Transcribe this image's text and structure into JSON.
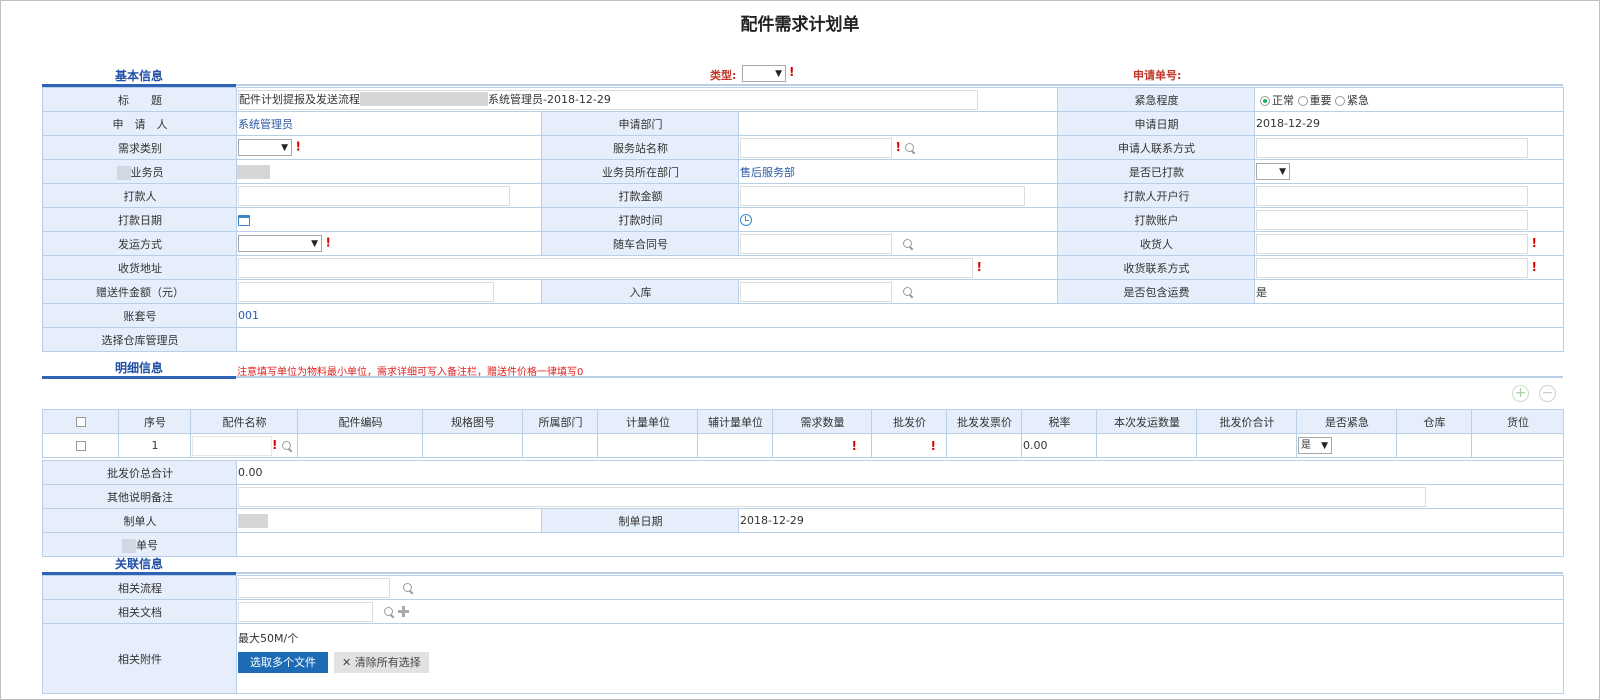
{
  "page": {
    "title": "配件需求计划单"
  },
  "top": {
    "type_label": "类型:",
    "apply_no_label": "申请单号:"
  },
  "sections": {
    "basic": "基本信息",
    "detail": "明细信息",
    "related": "关联信息"
  },
  "basic": {
    "title_label": "标　　题",
    "title_value_prefix": "配件计划提报及发送流程",
    "title_value_suffix": "系统管理员-2018-12-29",
    "urgency_label": "紧急程度",
    "urgency_options": [
      "正常",
      "重要",
      "紧急"
    ],
    "applicant_label": "申　请　人",
    "applicant_value": "系统管理员",
    "dept_label": "申请部门",
    "date_label": "申请日期",
    "date_value": "2018-12-29",
    "demand_type_label": "需求类别",
    "station_label": "服务站名称",
    "contact_label": "申请人联系方式",
    "salesman_label": "业务员",
    "salesman_dept_label": "业务员所在部门",
    "salesman_dept_value": "售后服务部",
    "paid_label": "是否已打款",
    "payer_label": "打款人",
    "amount_label": "打款金额",
    "payer_bank_label": "打款人开户行",
    "pay_date_label": "打款日期",
    "pay_time_label": "打款时间",
    "pay_account_label": "打款账户",
    "ship_method_label": "发运方式",
    "contract_label": "随车合同号",
    "receiver_label": "收货人",
    "address_label": "收货地址",
    "receiver_contact_label": "收货联系方式",
    "gift_amount_label": "赠送件金额（元）",
    "stock_label": "入库",
    "freight_label": "是否包含运费",
    "freight_value": "是",
    "account_set_label": "账套号",
    "account_set_value": "001",
    "warehouse_mgr_label": "选择仓库管理员"
  },
  "detail": {
    "note": "注意填写单位为物料最小单位，需求详细可写入备注栏，赠送件价格一律填写0",
    "columns": [
      "序号",
      "配件名称",
      "配件编码",
      "规格图号",
      "所属部门",
      "计量单位",
      "辅计量单位",
      "需求数量",
      "批发价",
      "批发发票价",
      "税率",
      "本次发运数量",
      "批发价合计",
      "是否紧急",
      "仓库",
      "货位"
    ],
    "row": {
      "index": "1",
      "tax_rate": "0.00",
      "urgent": "是"
    },
    "wholesale_total_label": "批发价总合计",
    "wholesale_total_value": "0.00",
    "remark_label": "其他说明备注",
    "maker_label": "制单人",
    "make_date_label": "制单日期",
    "make_date_value": "2018-12-29",
    "bill_no_label": "单号"
  },
  "related": {
    "flow_label": "相关流程",
    "doc_label": "相关文档",
    "attach_label": "相关附件",
    "max_size": "最大50M/个",
    "select_files_button": "选取多个文件",
    "clear_button": "清除所有选择"
  },
  "colors": {
    "header_bg": "#e5eefa",
    "border": "#b9cfe8",
    "accent": "#1d6bb5",
    "required": "#e00000"
  }
}
